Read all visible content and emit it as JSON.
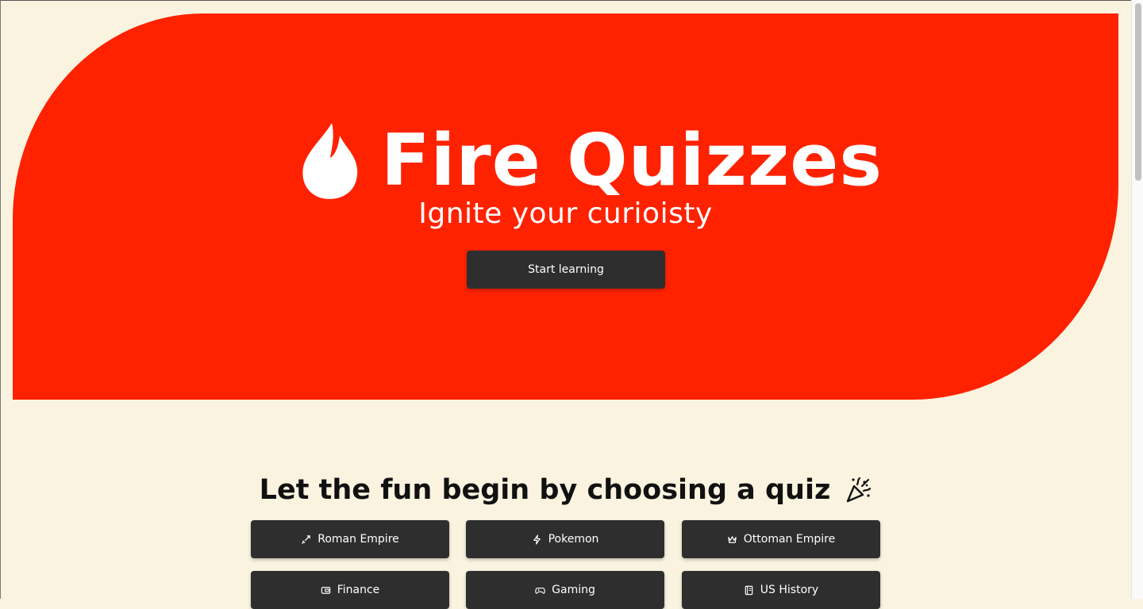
{
  "hero": {
    "title": "Fire Quizzes",
    "tagline": "Ignite your curioisty",
    "cta_label": "Start learning",
    "logo_icon": "flame-icon",
    "background_color": "#ff2200"
  },
  "quizzes_section": {
    "heading": "Let the fun begin by choosing a quiz",
    "heading_icon": "party-popper-icon",
    "items": [
      {
        "label": "Roman Empire",
        "icon": "sword-icon"
      },
      {
        "label": "Pokemon",
        "icon": "lightning-icon"
      },
      {
        "label": "Ottoman Empire",
        "icon": "crown-icon"
      },
      {
        "label": "Finance",
        "icon": "wallet-icon"
      },
      {
        "label": "Gaming",
        "icon": "gamepad-icon"
      },
      {
        "label": "US History",
        "icon": "book-icon"
      }
    ]
  },
  "colors": {
    "page_background": "#faf3e0",
    "button_background": "#2e2e2e",
    "accent": "#ff2200"
  }
}
